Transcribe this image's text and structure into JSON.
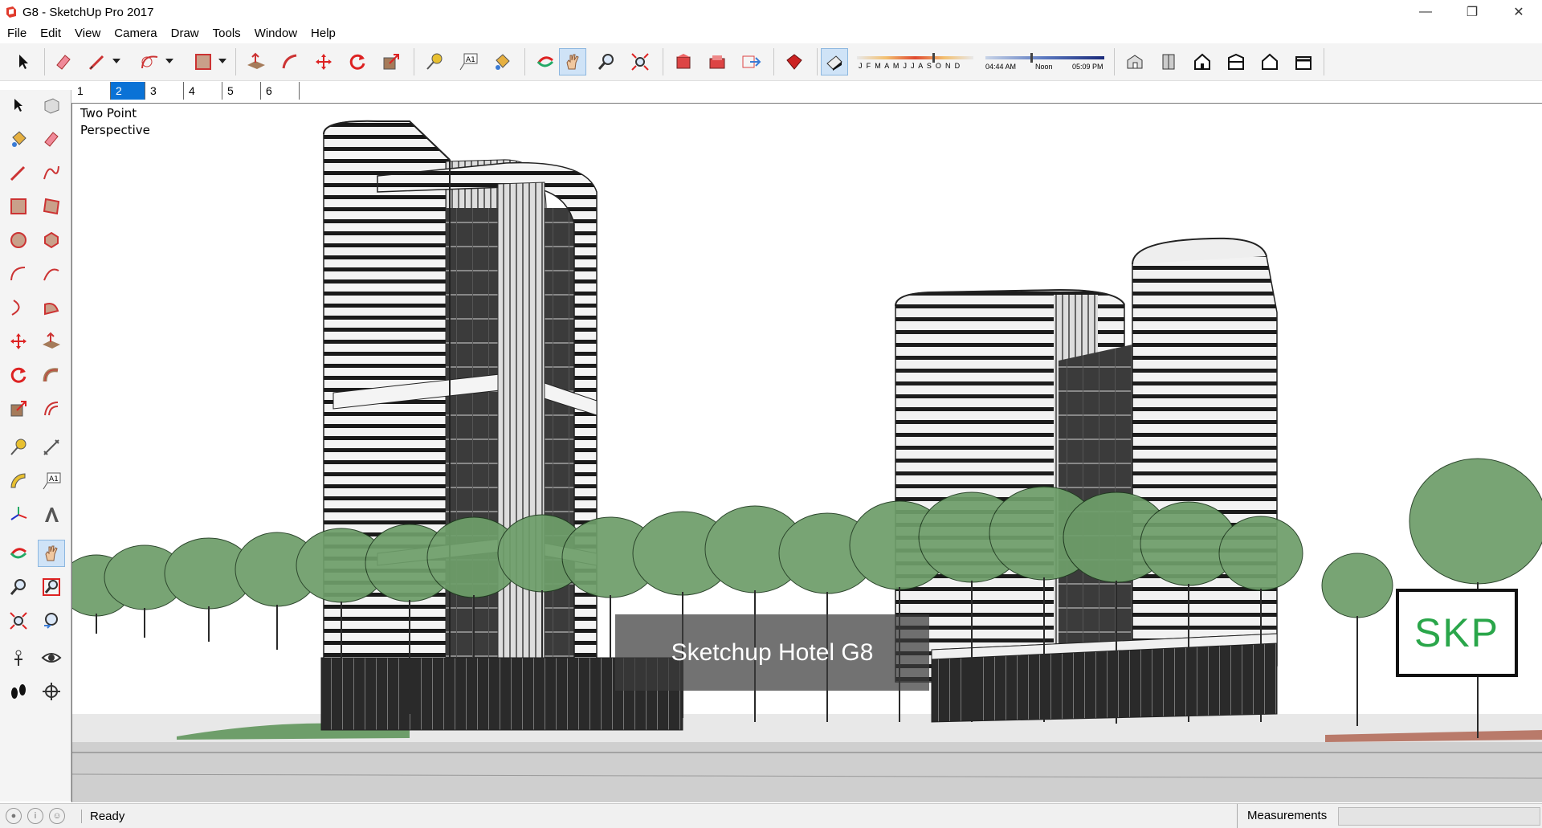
{
  "window": {
    "title": "G8 - SketchUp Pro 2017",
    "minimize": "—",
    "restore": "❐",
    "close": "✕"
  },
  "menu": [
    "File",
    "Edit",
    "View",
    "Camera",
    "Draw",
    "Tools",
    "Window",
    "Help"
  ],
  "shadows": {
    "months": "J F M A M J J A S O N D",
    "time_start": "04:44 AM",
    "time_mid": "Noon",
    "time_end": "05:09 PM"
  },
  "scenes": {
    "tabs": [
      "1",
      "2",
      "3",
      "4",
      "5",
      "6"
    ],
    "active_index": 1
  },
  "viewport": {
    "camera_label_line1": "Two Point",
    "camera_label_line2": "Perspective",
    "caption": "Sketchup Hotel G8",
    "logo": "SKP"
  },
  "status": {
    "text": "Ready",
    "measurements_label": "Measurements",
    "measurements_value": ""
  },
  "colors": {
    "accent": "#0a72d6",
    "logo_green": "#2aa64a",
    "tree_green": "#6e9e6a",
    "toolbar_bg": "#f4f4f4"
  }
}
